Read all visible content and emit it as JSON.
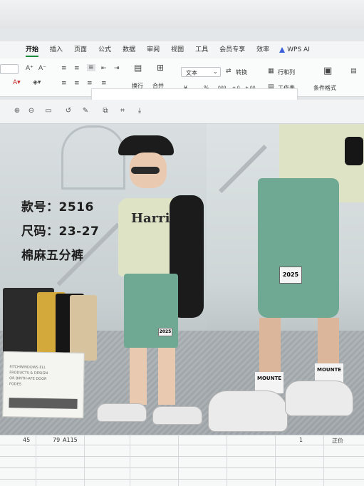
{
  "menu": {
    "tabs": [
      {
        "label": "开始",
        "active": true
      },
      {
        "label": "插入",
        "active": false
      },
      {
        "label": "页面",
        "active": false
      },
      {
        "label": "公式",
        "active": false
      },
      {
        "label": "数据",
        "active": false
      },
      {
        "label": "审阅",
        "active": false
      },
      {
        "label": "视图",
        "active": false
      },
      {
        "label": "工具",
        "active": false
      },
      {
        "label": "会员专享",
        "active": false
      },
      {
        "label": "效率",
        "active": false
      }
    ],
    "ai_label": "WPS AI"
  },
  "ribbon": {
    "wrap_label": "换行",
    "merge_label": "合并",
    "number_format": "文本",
    "convert_label": "转换",
    "rows_cols_label": "行和列",
    "worksheet_label": "工作表",
    "cond_format_label": "条件格式",
    "currency_symbol": "¥",
    "percent_symbol": "%",
    "dec_a": "000",
    "dec_b": "+.0",
    "dec_c": "+.00"
  },
  "photo": {
    "style_no": "款号：2516",
    "sizes": "尺码：23-27",
    "material": "棉麻五分裤",
    "shirt_print": "Harris",
    "patch_label": "2025",
    "sock_text": "MOUNTE",
    "sign_lines": [
      "FITCHWINDOWS ELL",
      "FRODUCTS & DESIGN",
      "OR BINTH-AFE DOOR",
      "FODES"
    ]
  },
  "sheet": {
    "cells": [
      "45",
      "79",
      "A115",
      "1",
      "正价"
    ]
  },
  "colors": {
    "accent": "#1a8a3a",
    "ai_icon": "#3a5fd9",
    "shorts_green": "#6fa893",
    "shirt": "#dfe3c6"
  }
}
